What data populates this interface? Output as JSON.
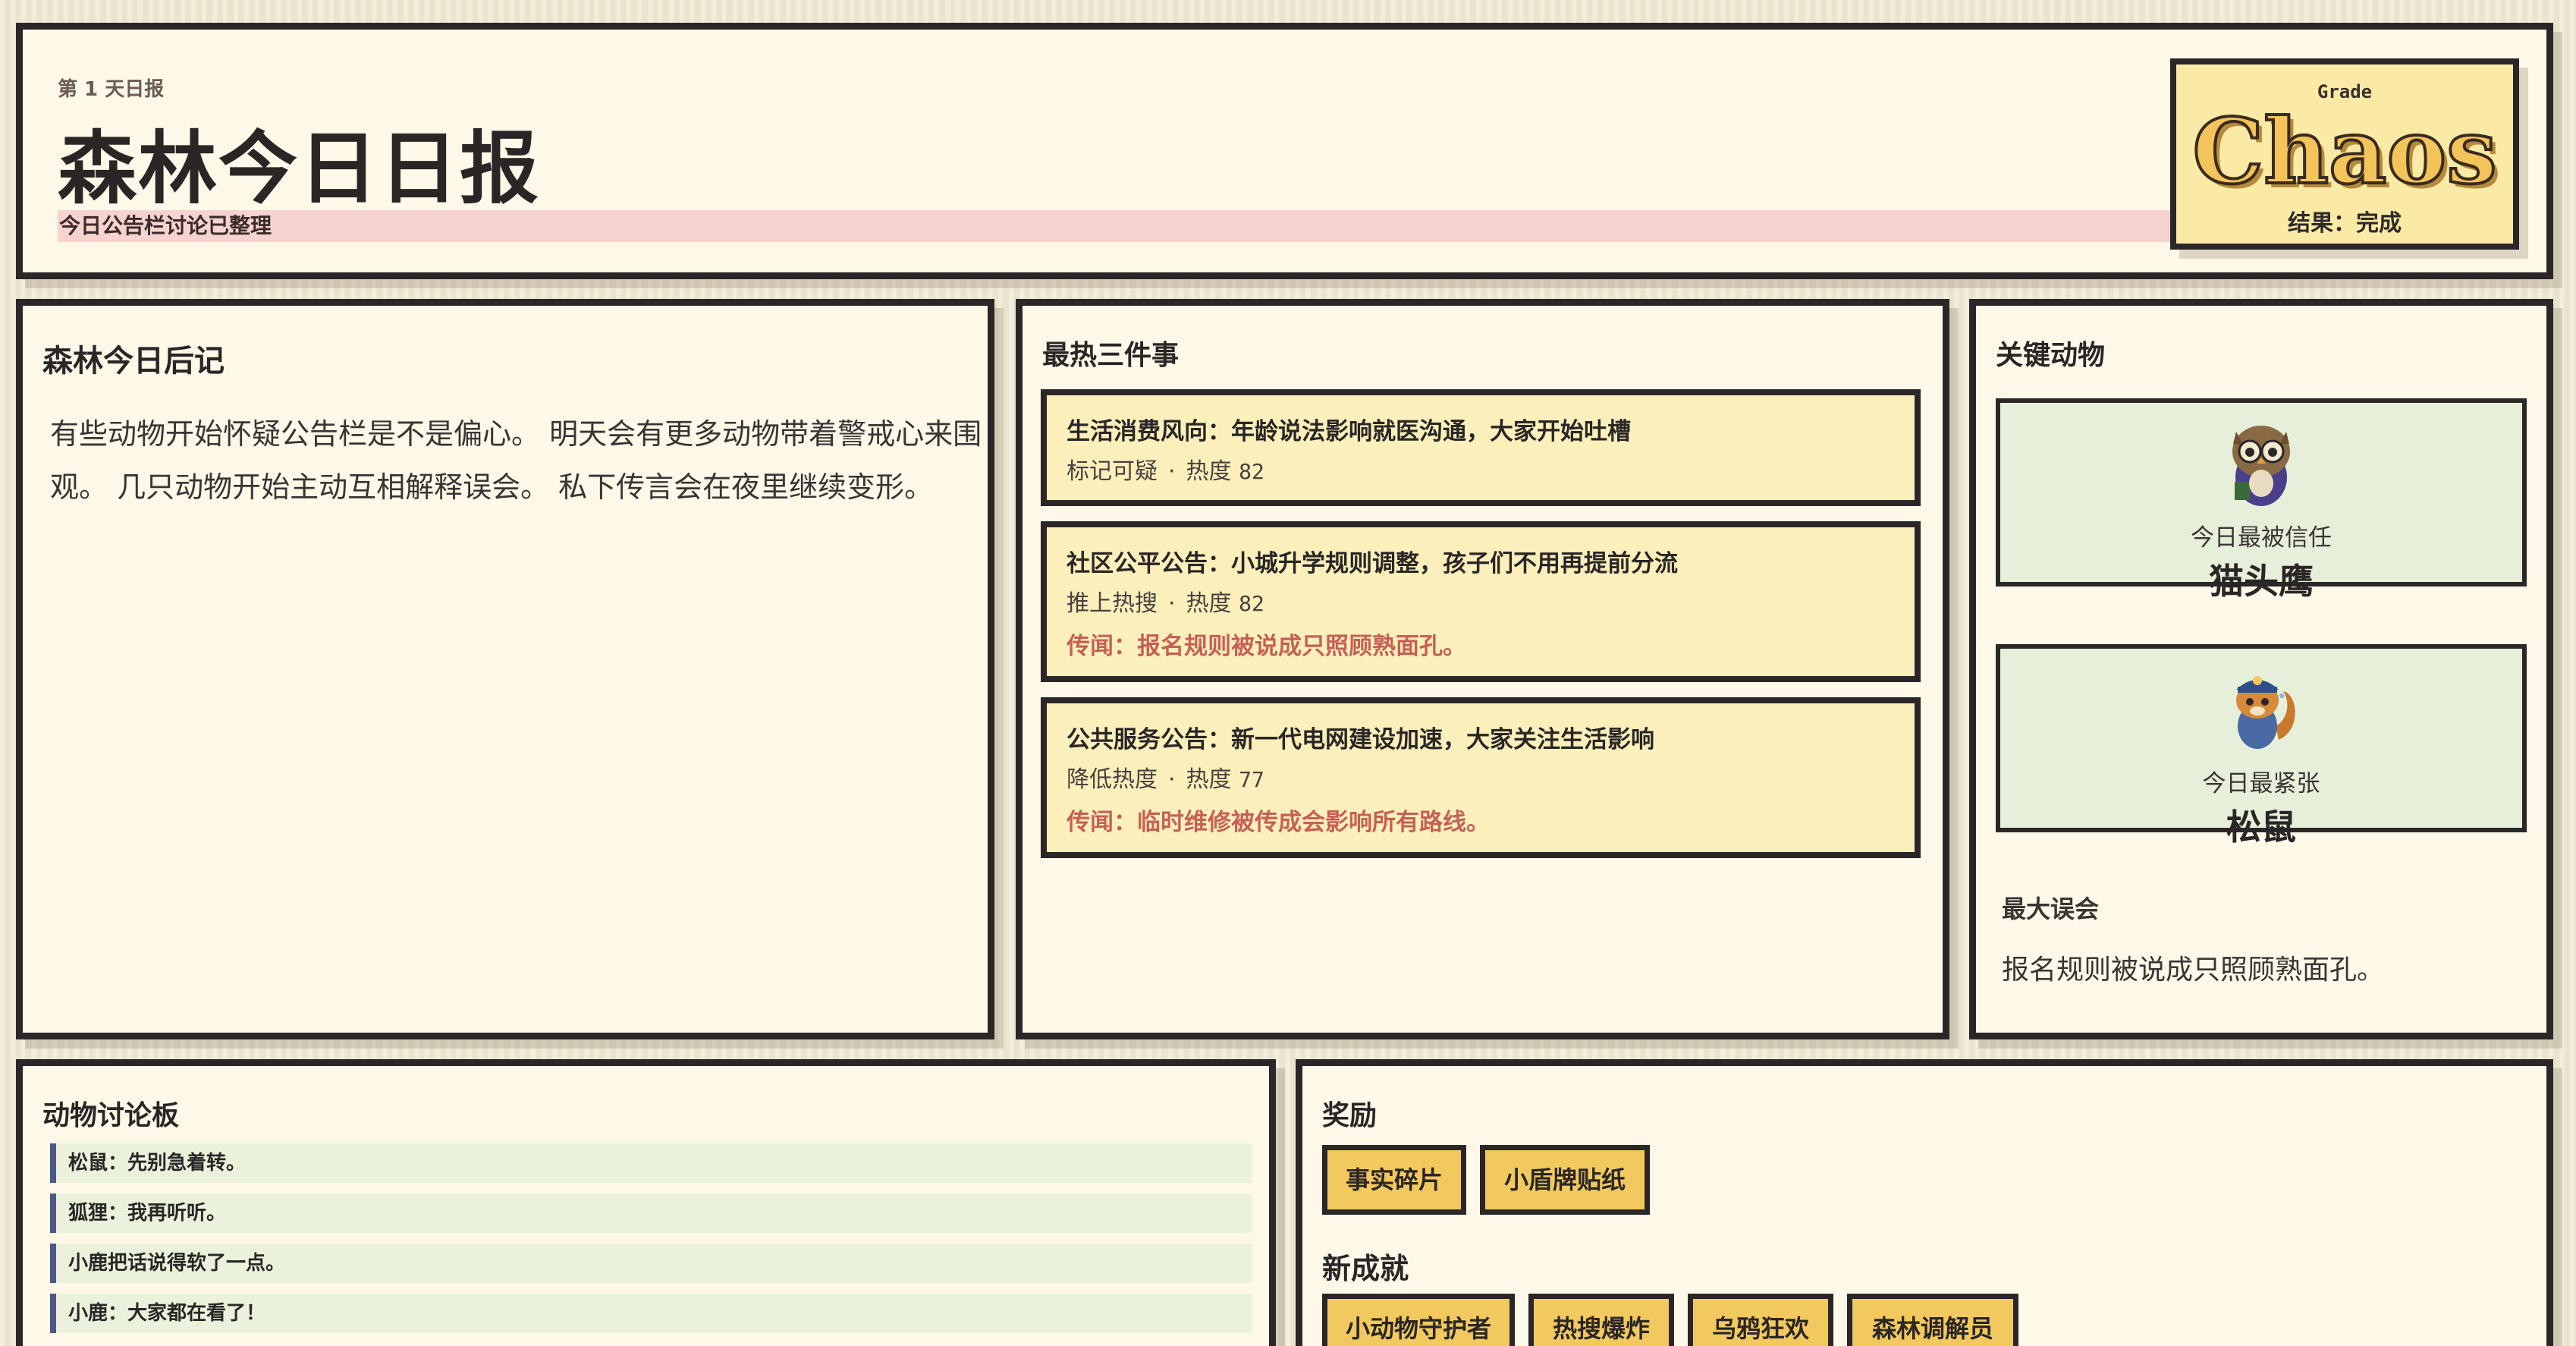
{
  "header": {
    "day": "第 1 天日报",
    "title": "森林今日日报",
    "subtitle": "今日公告栏讨论已整理",
    "grade": {
      "label": "Grade",
      "value": "Chaos",
      "result": "结果：完成"
    }
  },
  "epilogue": {
    "title": "森林今日后记",
    "text": "有些动物开始怀疑公告栏是不是偏心。 明天会有更多动物带着警戒心来围观。 几只动物开始主动互相解释误会。 私下传言会在夜里继续变形。"
  },
  "hot": {
    "title": "最热三件事",
    "items": [
      {
        "title": "生活消费风向：年龄说法影响就医沟通，大家开始吐槽",
        "action": "标记可疑",
        "heat_label": "热度",
        "heat": "82",
        "rumor": ""
      },
      {
        "title": "社区公平公告：小城升学规则调整，孩子们不用再提前分流",
        "action": "推上热搜",
        "heat_label": "热度",
        "heat": "82",
        "rumor": "传闻：报名规则被说成只照顾熟面孔。"
      },
      {
        "title": "公共服务公告：新一代电网建设加速，大家关注生活影响",
        "action": "降低热度",
        "heat_label": "热度",
        "heat": "77",
        "rumor": "传闻：临时维修被传成会影响所有路线。"
      }
    ]
  },
  "animals": {
    "title": "关键动物",
    "trusted": {
      "sub": "今日最被信任",
      "name": "猫头鹰",
      "icon": "owl-icon"
    },
    "nervous": {
      "sub": "今日最紧张",
      "name": "松鼠",
      "icon": "squirrel-icon"
    },
    "misread_label": "最大误会",
    "misread_text": "报名规则被说成只照顾熟面孔。"
  },
  "board": {
    "title": "动物讨论板",
    "messages": [
      "松鼠：先别急着转。",
      "狐狸：我再听听。",
      "小鹿把话说得软了一点。",
      "小鹿：大家都在看了！"
    ]
  },
  "rewards": {
    "title": "奖励",
    "items": [
      "事实碎片",
      "小盾牌贴纸"
    ],
    "achievements_title": "新成就",
    "achievements": [
      "小动物守护者",
      "热搜爆炸",
      "乌鸦狂欢",
      "森林调解员"
    ]
  },
  "colors": {
    "panel": "#fdf8e8",
    "border": "#2b2728",
    "hot_card": "#fbf0bb",
    "animal_card": "#e6efd9",
    "rumor": "#c66057",
    "tag": "#f2c95f",
    "subtitle_bar": "#f6d3cf"
  }
}
